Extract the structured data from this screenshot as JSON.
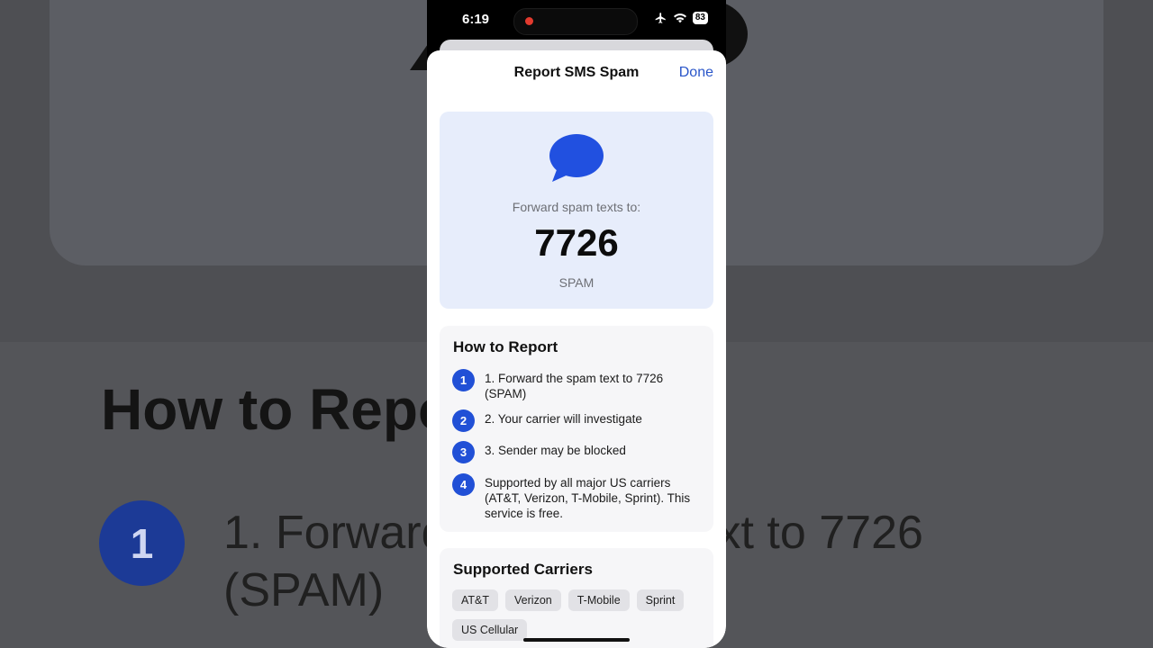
{
  "status_bar": {
    "time": "6:19",
    "battery": "83",
    "icons": [
      "airplane-icon",
      "wifi-icon",
      "battery-icon"
    ]
  },
  "background": {
    "heading": "How to Repo",
    "step_number": "1",
    "step_text_line1": "1. Forward",
    "step_text_line1_end": "xt to 7726",
    "step_text_line2": "(SPAM)"
  },
  "sheet": {
    "title": "Report SMS Spam",
    "done_label": "Done"
  },
  "hero": {
    "icon": "message-bubble-icon",
    "label": "Forward spam texts to:",
    "number": "7726",
    "word": "SPAM"
  },
  "how_to_report": {
    "title": "How to Report",
    "steps": [
      {
        "num": "1",
        "text": "1. Forward the spam text to 7726 (SPAM)"
      },
      {
        "num": "2",
        "text": "2. Your carrier will investigate"
      },
      {
        "num": "3",
        "text": "3. Sender may be blocked"
      },
      {
        "num": "4",
        "text": "Supported by all major US carriers (AT&T, Verizon, T-Mobile, Sprint). This service is free."
      }
    ]
  },
  "supported_carriers": {
    "title": "Supported Carriers",
    "carriers": [
      "AT&T",
      "Verizon",
      "T-Mobile",
      "Sprint",
      "US Cellular"
    ]
  },
  "colors": {
    "accent": "#2150d6",
    "link": "#2a56c9",
    "hero_bg": "#e7edfb"
  }
}
